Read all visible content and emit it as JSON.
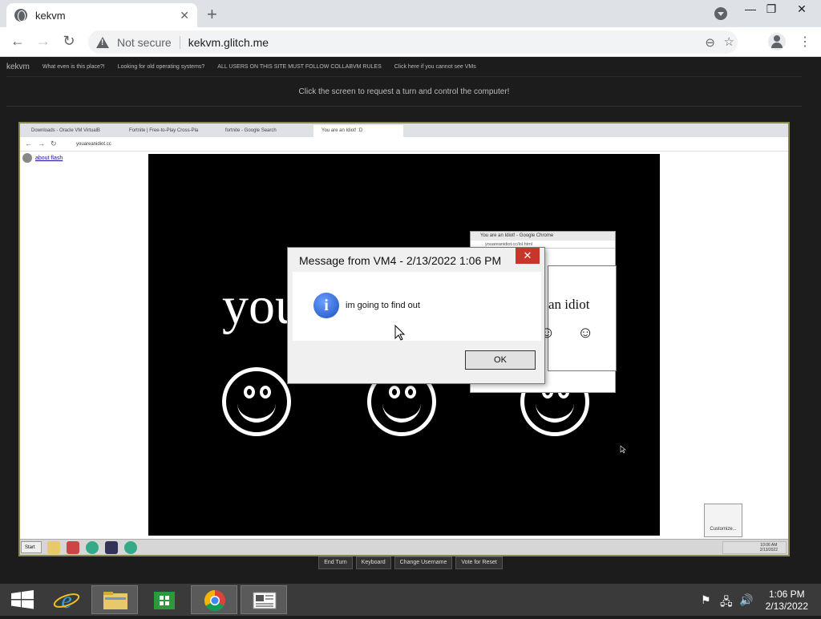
{
  "browser": {
    "tab_title": "kekvm",
    "tab_close": "✕",
    "new_tab": "+",
    "window_min": "—",
    "window_restore": "❐",
    "window_close": "✕",
    "not_secure": "Not secure",
    "url": "kekvm.glitch.me"
  },
  "site": {
    "brand": "kekvm",
    "nav": [
      "What even is this place?!",
      "Looking for old operating systems?",
      "ALL USERS ON THIS SITE MUST FOLLOW COLLABVM RULES",
      "Click here if you cannot see VMs"
    ],
    "hint": "Click the screen to request a turn and control the computer!",
    "actions": [
      "End Turn",
      "Keyboard",
      "Change Username",
      "Vote for Reset"
    ]
  },
  "vm": {
    "tabs": [
      "Downloads - Oracle VM VirtualB",
      "Fortnite | Free-to-Play Cross-Pla",
      "fortnite - Google Search",
      "You are an Idiot! :D"
    ],
    "inner_url": "youareanidiot.cc",
    "about_flash": "about flash",
    "big_word": "you",
    "mini_window": {
      "title": "You are an Idiot! - Google Chrome",
      "url": "youareanidiot.cc/lol.html",
      "text": "an idiot",
      "smiles": [
        "☺",
        "☺"
      ]
    },
    "dialog": {
      "title": "Message from VM4 - 2/13/2022 1:06 PM",
      "close": "✕",
      "icon": "i",
      "message": "im going to find out",
      "ok": "OK"
    },
    "start": "Start",
    "customize": "Customize...",
    "inner_time": "10:06 AM",
    "inner_date": "2/13/2022"
  },
  "taskbar": {
    "time": "1:06 PM",
    "date": "2/13/2022"
  }
}
